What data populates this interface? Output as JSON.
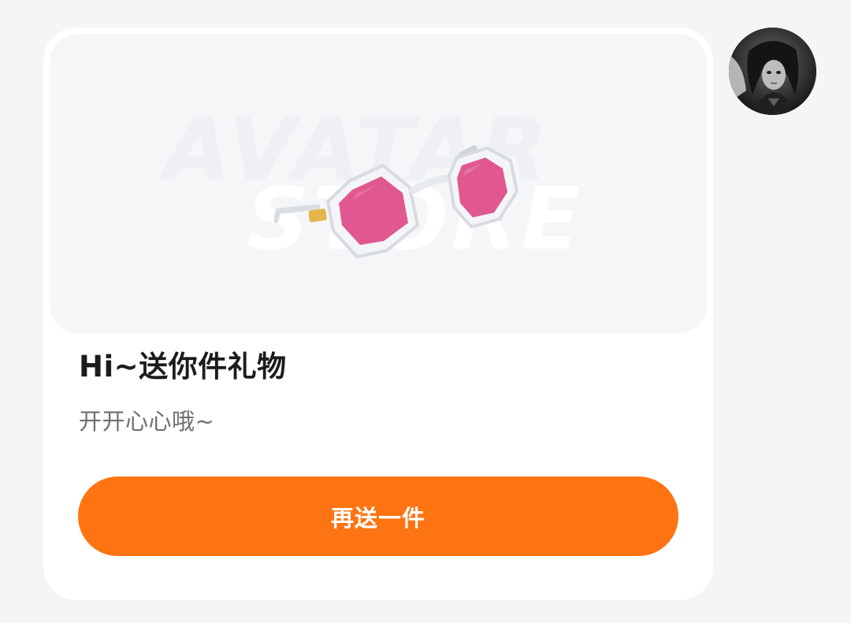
{
  "card": {
    "watermark_line1": "AVATAR",
    "watermark_line2": "STORE",
    "gift_item_icon": "sunglasses-pink-lens",
    "title": "Hi~送你件礼物",
    "message": "开开心心哦~",
    "send_again_label": "再送一件"
  },
  "sender": {
    "avatar_icon": "user-avatar-portrait"
  },
  "colors": {
    "accent": "#ff7412",
    "background": "#f4f5f7",
    "card": "#ffffff",
    "lens": "#e0588f"
  }
}
